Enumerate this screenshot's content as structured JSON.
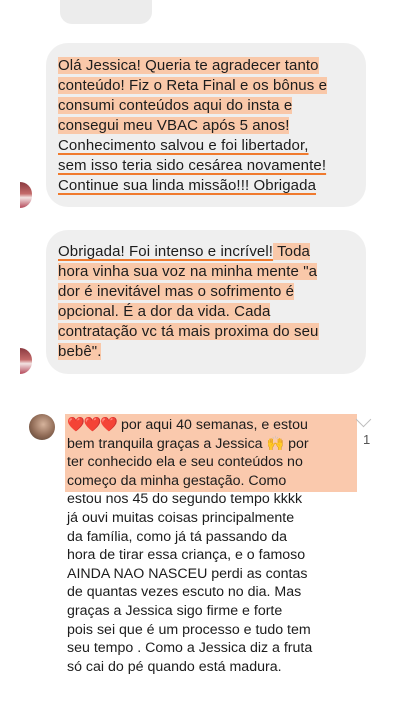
{
  "message1": {
    "lines": [
      "Olá Jessica! Queria te agradecer tanto",
      "conteúdo! Fiz o Reta Final e os bônus e",
      "consumi conteúdos aqui do insta e",
      "consegui meu VBAC após 5 anos!",
      "Conhecimento salvou e foi libertador,",
      "sem isso teria sido cesárea novamente!",
      "Continue sua linda missão!!! Obrigada"
    ]
  },
  "message2": {
    "line1_underlined": "Obrigada! Foi intenso e incrível!",
    "line1_rest": " Toda",
    "lines": [
      "hora vinha sua voz na minha mente \"a",
      "dor é inevitável mas o sofrimento é",
      "opcional. É a dor da vida. Cada",
      "contratação vc tá mais proxima do seu",
      "bebê\"."
    ]
  },
  "comment": {
    "hearts": "❤️❤️❤️",
    "line1_rest": " por aqui 40 semanas, e estou",
    "line2_a": "bem tranquila graças a Jessica ",
    "hands_emoji": "🙌",
    "line2_b": " por",
    "lines": [
      "ter conhecido ela e seu conteúdos no",
      "começo da minha gestação.  Como",
      "estou nos 45 do segundo tempo kkkk",
      "já ouvi muitas coisas principalmente",
      "da família,  como já tá passando da",
      "hora de tirar essa criança,  e o famoso",
      "AINDA NAO NASCEU  perdi as contas",
      "de quantas vezes escuto no dia. Mas",
      "graças a Jessica sigo firme e forte",
      "pois sei que é um processo e tudo tem",
      "seu tempo . Como a Jessica diz a fruta",
      "só cai do pé quando está madura."
    ],
    "like_count": "1"
  },
  "colors": {
    "bubble": "#efefef",
    "highlight": "#f9c8a9",
    "underline": "#f07a2e"
  }
}
